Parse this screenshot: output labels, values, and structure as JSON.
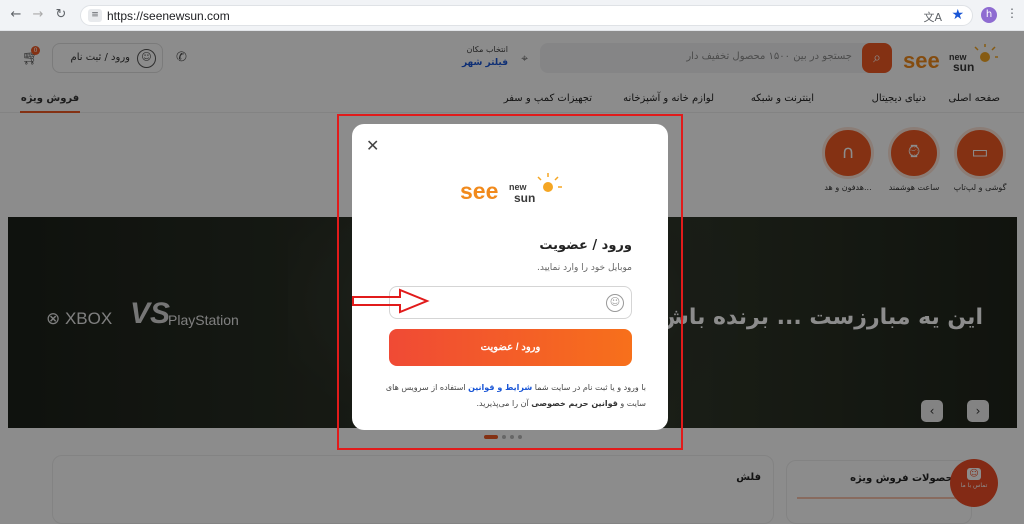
{
  "browser": {
    "url": "https://seenewsun.com",
    "profile_initial": "h"
  },
  "header": {
    "search_placeholder": "جستجو در بین ۱۵۰۰ محصول تخفیف دار",
    "location_label": "انتخاب مکان",
    "location_value": "فیلتر شهر",
    "login_label": "ورود / ثبت نام",
    "cart_count": "0"
  },
  "nav": {
    "items": [
      "صفحه اصلی",
      "دنیای دیجیتال",
      "اینترنت و شبکه",
      "لوازم خانه و آشپزخانه",
      "تجهیزات کمپ و سفر"
    ],
    "special": "فروش ویژه"
  },
  "categories": [
    {
      "label": "گوشی و لپ‌تاپ"
    },
    {
      "label": "ساعت هوشمند"
    },
    {
      "label": "هدفون و هد..."
    }
  ],
  "banner": {
    "headline": "این یه مبارزست ... برنده باش!",
    "brand_left": "XBOX",
    "brand_vs": "VS",
    "brand_right": "PlayStation"
  },
  "sections": {
    "flash": "فلش",
    "special_products": "محصولات فروش ویژه",
    "support": "تماس با ما"
  },
  "modal": {
    "title": "ورود / عضویت",
    "hint": "موبایل خود را وارد نمایید.",
    "input_value": "",
    "submit": "ورود / عضویت",
    "terms_1": "با ورود و یا ثبت نام در سایت شما ",
    "terms_link": "شرایط و قوانین",
    "terms_2": " استفاده از سرویس های سایت و ",
    "terms_bold": "قوانین حریم خصوصی",
    "terms_3": " آن را می‌پذیرید."
  },
  "colors": {
    "brand_orange": "#f15a24",
    "annotation_red": "#e11b1b"
  }
}
